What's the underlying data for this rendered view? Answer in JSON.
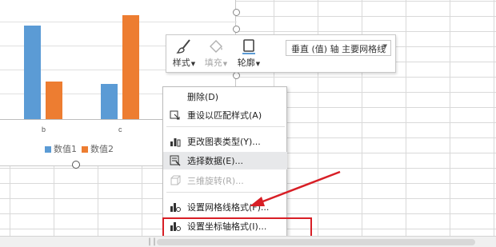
{
  "chart_data": {
    "type": "bar",
    "categories": [
      "b",
      "c"
    ],
    "series": [
      {
        "name": "数值1",
        "values": [
          4.5,
          1.7
        ]
      },
      {
        "name": "数值2",
        "values": [
          1.8,
          5.0
        ]
      }
    ],
    "colors": [
      "#5b9bd5",
      "#ed7d31"
    ],
    "legend_position": "bottom",
    "grid": true
  },
  "toolbar": {
    "style_label": "样式",
    "fill_label": "填充",
    "outline_label": "轮廓",
    "element_select_value": "垂直 (值) 轴 主要网格线"
  },
  "menu": {
    "items": [
      {
        "label": "删除(D)",
        "icon": "none",
        "enabled": true
      },
      {
        "label": "重设以匹配样式(A)",
        "icon": "reset-style-icon",
        "enabled": true
      },
      {
        "label": "更改图表类型(Y)...",
        "icon": "change-chart-type-icon",
        "enabled": true
      },
      {
        "label": "选择数据(E)...",
        "icon": "select-data-icon",
        "enabled": true
      },
      {
        "label": "三维旋转(R)...",
        "icon": "3d-rotation-icon",
        "enabled": false
      },
      {
        "label": "设置网格线格式(F)...",
        "icon": "format-gridlines-icon",
        "enabled": true
      },
      {
        "label": "设置坐标轴格式(I)...",
        "icon": "format-axis-icon",
        "enabled": true
      }
    ]
  },
  "annotation": {
    "color": "#d81f26"
  }
}
